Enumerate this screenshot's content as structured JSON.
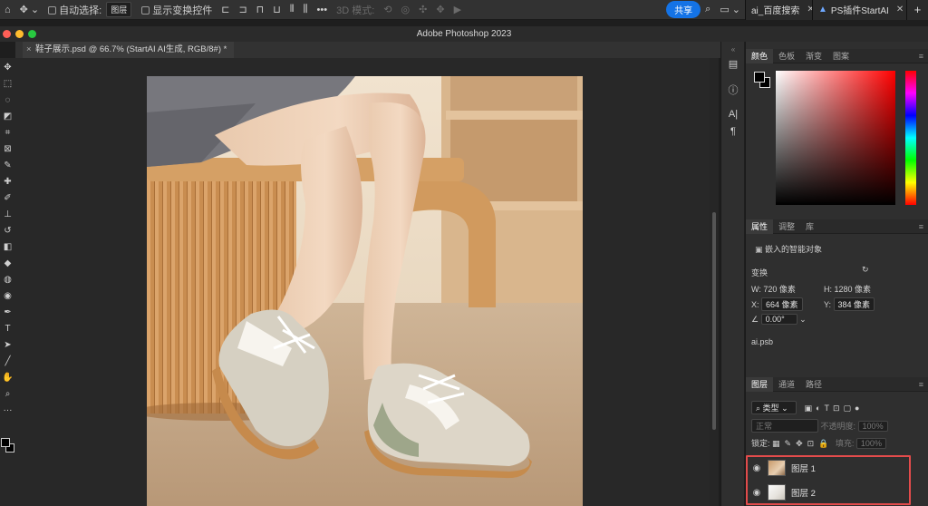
{
  "options_bar": {
    "auto_select_label": "自动选择:",
    "layer_select": "图层",
    "show_transform_label": "显示变换控件",
    "mode_3d_label": "3D 模式:",
    "share_label": "共享"
  },
  "browser_tabs": [
    {
      "label": "ai_百度搜索"
    },
    {
      "label": "PS插件StartAI"
    }
  ],
  "app_title": "Adobe Photoshop 2023",
  "document_tab": "鞋子展示.psd @ 66.7% (StartAI AI生成, RGB/8#) *",
  "color_panel": {
    "tabs": [
      "颜色",
      "色板",
      "渐变",
      "图案"
    ]
  },
  "properties_panel": {
    "tabs": [
      "属性",
      "调整",
      "库"
    ],
    "object_type": "嵌入的智能对象",
    "transform_label": "变换",
    "w_label": "W:",
    "w_value": "720 像素",
    "h_label": "H:",
    "h_value": "1280 像素",
    "x_label": "X:",
    "x_value": "664 像素",
    "y_label": "Y:",
    "y_value": "384 像素",
    "angle_value": "0.00°",
    "file_name": "ai.psb"
  },
  "layers_panel": {
    "tabs": [
      "图层",
      "通道",
      "路径"
    ],
    "filter_label": "类型",
    "blend_mode": "正常",
    "opacity_label": "不透明度:",
    "opacity_value": "100%",
    "lock_label": "锁定:",
    "fill_label": "填充:",
    "fill_value": "100%",
    "layers": [
      {
        "name": "图层 1"
      },
      {
        "name": "图层 2"
      }
    ]
  },
  "colors": {
    "accent": "#1473e6",
    "highlight": "#e34b4b"
  }
}
